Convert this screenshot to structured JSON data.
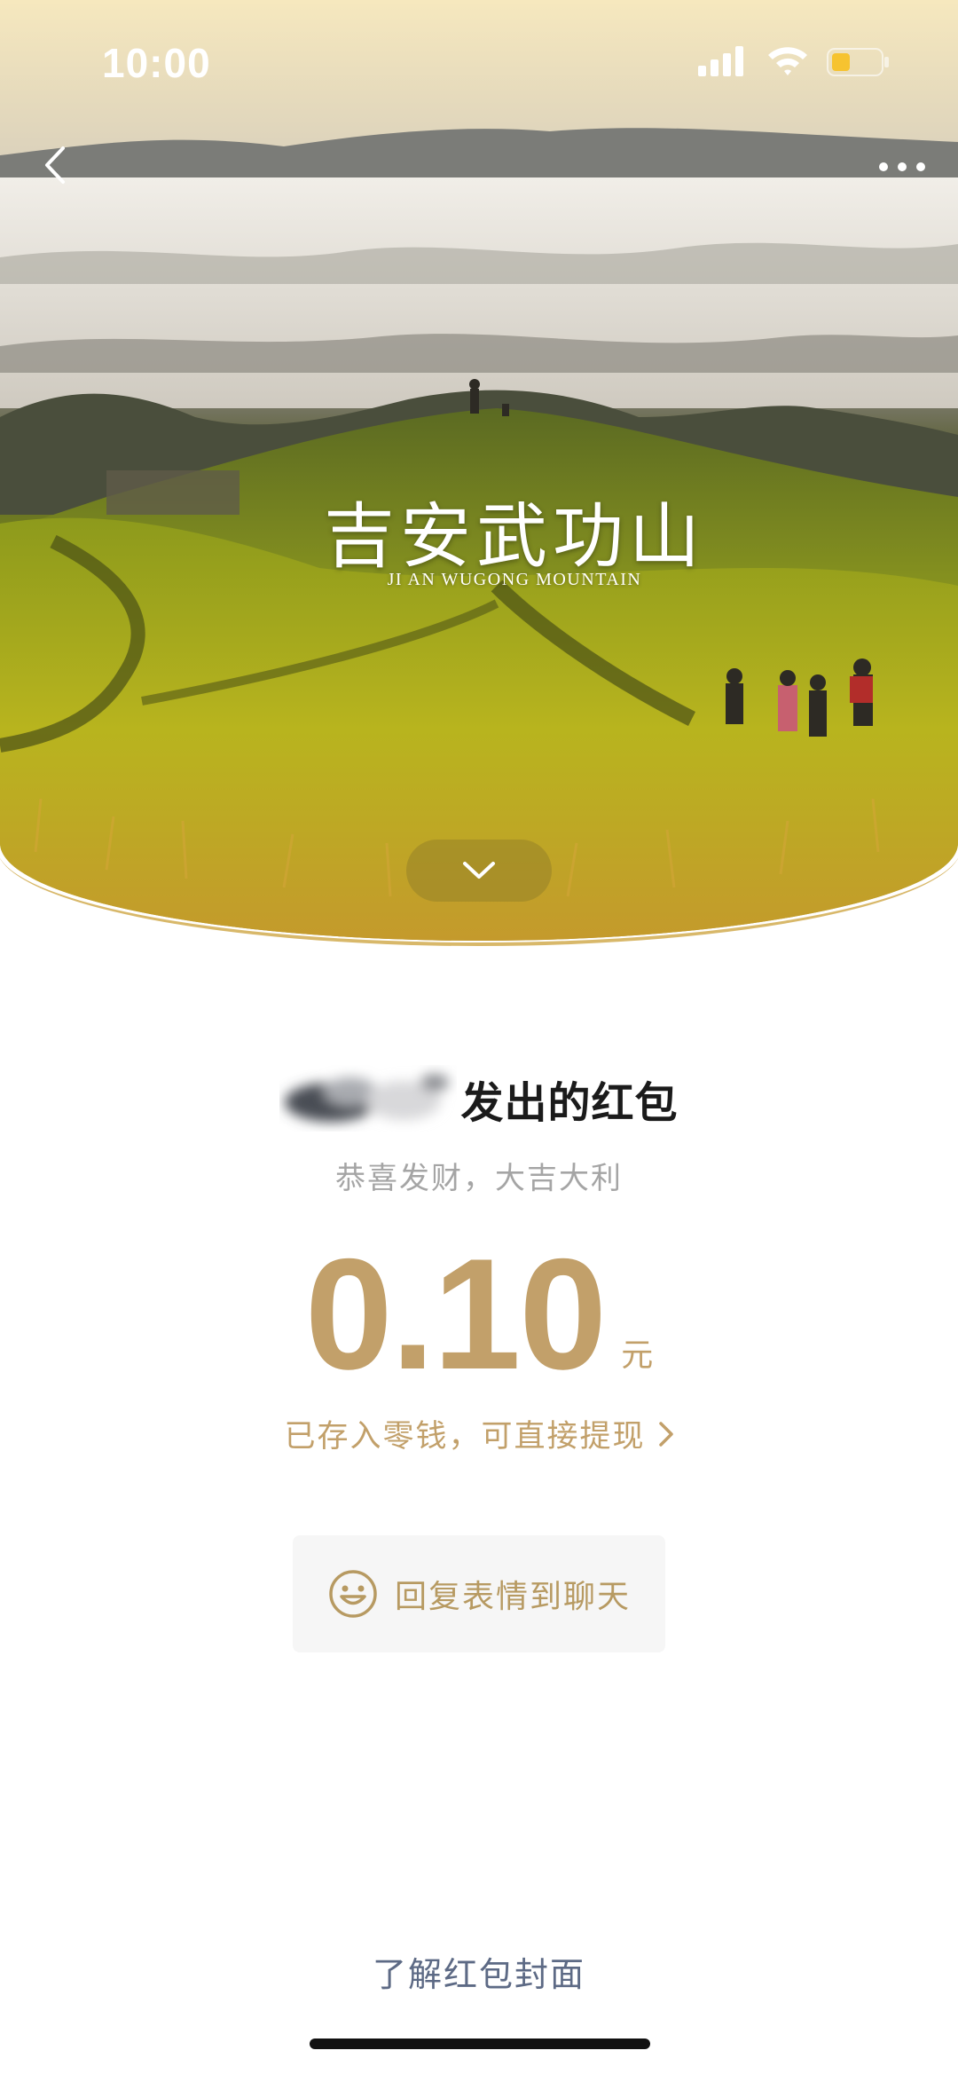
{
  "status_bar": {
    "time": "10:00",
    "signal_icon": "cellular-signal-icon",
    "wifi_icon": "wifi-icon",
    "battery_icon": "battery-low-icon",
    "battery_color": "#f6c330"
  },
  "nav": {
    "back_icon": "chevron-left-icon",
    "more_icon": "more-dots-icon"
  },
  "cover": {
    "title": "吉安武功山",
    "subtitle": "JI AN WUGONG MOUNTAIN",
    "collapse_icon": "chevron-down-icon",
    "rim_color": "#d8b86a"
  },
  "red_packet": {
    "sender_suffix": "发出的红包",
    "greeting": "恭喜发财，大吉大利",
    "amount": "0.10",
    "currency": "元",
    "stored_text": "已存入零钱，可直接提现",
    "accent_color": "#c2a06a"
  },
  "reply": {
    "icon": "smiley-face-icon",
    "label": "回复表情到聊天"
  },
  "footer": {
    "learn_cover": "了解红包封面"
  }
}
